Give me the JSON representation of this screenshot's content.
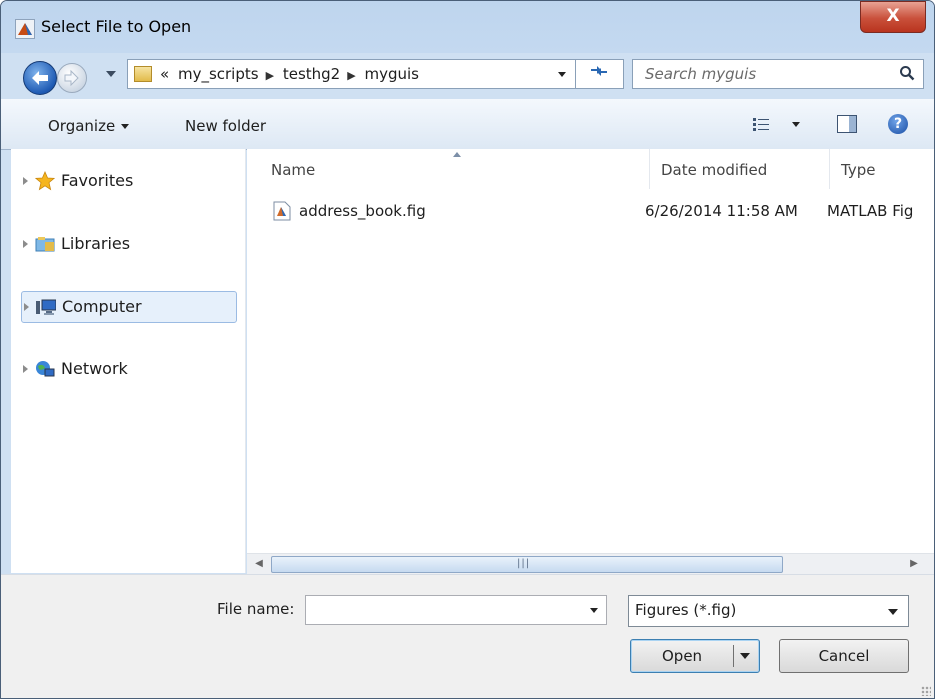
{
  "window": {
    "title": "Select File to Open",
    "close_label": "X"
  },
  "nav": {
    "address_crumbs": [
      "«",
      "my_scripts",
      "testhg2",
      "myguis"
    ],
    "search_placeholder": "Search myguis"
  },
  "toolbar": {
    "organize_label": "Organize",
    "new_folder_label": "New folder"
  },
  "sidebar": {
    "items": [
      {
        "label": "Favorites",
        "icon": "star-icon"
      },
      {
        "label": "Libraries",
        "icon": "library-icon"
      },
      {
        "label": "Computer",
        "icon": "computer-icon",
        "selected": true
      },
      {
        "label": "Network",
        "icon": "network-icon"
      }
    ]
  },
  "files": {
    "columns": [
      "Name",
      "Date modified",
      "Type"
    ],
    "rows": [
      {
        "name": "address_book.fig",
        "date": "6/26/2014 11:58 AM",
        "type": "MATLAB Fig"
      }
    ]
  },
  "footer": {
    "file_name_label": "File name:",
    "file_name_value": "",
    "filter_value": "Figures (*.fig)",
    "open_label": "Open",
    "cancel_label": "Cancel"
  },
  "colors": {
    "titlebar": "#c4d9f0",
    "close": "#c9503b",
    "selection": "#e6f0fb"
  }
}
